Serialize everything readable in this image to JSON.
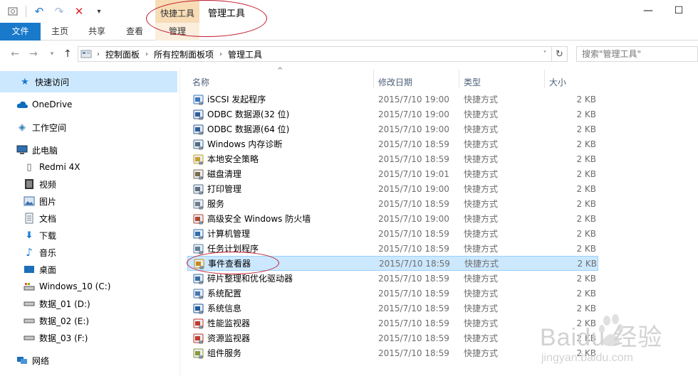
{
  "titlebar": {
    "qat_icons": [
      "properties-icon",
      "undo-icon",
      "redo-icon",
      "delete-icon",
      "dropdown-icon"
    ],
    "context_group": "快捷工具",
    "window_title": "管理工具",
    "minimize": "—",
    "maximize": "☐"
  },
  "ribbon": {
    "tabs": [
      "文件",
      "主页",
      "共享",
      "查看",
      "管理"
    ]
  },
  "address": {
    "crumbs": [
      "控制面板",
      "所有控制面板项",
      "管理工具"
    ],
    "search_placeholder": "搜索\"管理工具\""
  },
  "sidebar": {
    "items": [
      {
        "label": "快速访问",
        "icon": "star-icon",
        "color": "#1979ca"
      },
      {
        "label": "OneDrive",
        "icon": "cloud-icon",
        "color": "#0f6cbd"
      },
      {
        "label": "工作空间",
        "icon": "workspace-icon",
        "color": "#2f7fb5"
      },
      {
        "label": "此电脑",
        "icon": "computer-icon",
        "color": "#2e6fb0"
      },
      {
        "label": "Redmi 4X",
        "icon": "phone-icon",
        "color": "#555555"
      },
      {
        "label": "视频",
        "icon": "video-icon",
        "color": "#333333"
      },
      {
        "label": "图片",
        "icon": "pictures-icon",
        "color": "#3d6ea8"
      },
      {
        "label": "文档",
        "icon": "documents-icon",
        "color": "#6b7b8c"
      },
      {
        "label": "下载",
        "icon": "download-icon",
        "color": "#1c7ed6"
      },
      {
        "label": "音乐",
        "icon": "music-icon",
        "color": "#1c7ed6"
      },
      {
        "label": "桌面",
        "icon": "desktop-icon",
        "color": "#1c6fb8"
      },
      {
        "label": "Windows_10 (C:)",
        "icon": "drive-c-icon",
        "color": "#555555"
      },
      {
        "label": "数据_01 (D:)",
        "icon": "drive-icon",
        "color": "#555555"
      },
      {
        "label": "数据_02 (E:)",
        "icon": "drive-icon",
        "color": "#555555"
      },
      {
        "label": "数据_03 (F:)",
        "icon": "drive-icon",
        "color": "#555555"
      },
      {
        "label": "网络",
        "icon": "network-icon",
        "color": "#1c6fb8"
      }
    ]
  },
  "filelist": {
    "columns": [
      "名称",
      "修改日期",
      "类型",
      "大小"
    ],
    "rows": [
      {
        "name": "iSCSI 发起程序",
        "date": "2015/7/10 19:00",
        "type": "快捷方式",
        "size": "2 KB",
        "icon": "iscsi-icon"
      },
      {
        "name": "ODBC 数据源(32 位)",
        "date": "2015/7/10 19:00",
        "type": "快捷方式",
        "size": "2 KB",
        "icon": "odbc-icon"
      },
      {
        "name": "ODBC 数据源(64 位)",
        "date": "2015/7/10 19:00",
        "type": "快捷方式",
        "size": "2 KB",
        "icon": "odbc-icon"
      },
      {
        "name": "Windows 内存诊断",
        "date": "2015/7/10 18:59",
        "type": "快捷方式",
        "size": "2 KB",
        "icon": "memory-diagnostic-icon"
      },
      {
        "name": "本地安全策略",
        "date": "2015/7/10 18:59",
        "type": "快捷方式",
        "size": "2 KB",
        "icon": "security-policy-icon"
      },
      {
        "name": "磁盘清理",
        "date": "2015/7/10 19:01",
        "type": "快捷方式",
        "size": "2 KB",
        "icon": "disk-cleanup-icon"
      },
      {
        "name": "打印管理",
        "date": "2015/7/10 19:00",
        "type": "快捷方式",
        "size": "2 KB",
        "icon": "printer-icon"
      },
      {
        "name": "服务",
        "date": "2015/7/10 18:59",
        "type": "快捷方式",
        "size": "2 KB",
        "icon": "services-icon"
      },
      {
        "name": "高级安全 Windows 防火墙",
        "date": "2015/7/10 19:00",
        "type": "快捷方式",
        "size": "2 KB",
        "icon": "firewall-icon"
      },
      {
        "name": "计算机管理",
        "date": "2015/7/10 18:59",
        "type": "快捷方式",
        "size": "2 KB",
        "icon": "computer-management-icon"
      },
      {
        "name": "任务计划程序",
        "date": "2015/7/10 18:59",
        "type": "快捷方式",
        "size": "2 KB",
        "icon": "task-scheduler-icon"
      },
      {
        "name": "事件查看器",
        "date": "2015/7/10 18:59",
        "type": "快捷方式",
        "size": "2 KB",
        "icon": "event-viewer-icon",
        "selected": true
      },
      {
        "name": "碎片整理和优化驱动器",
        "date": "2015/7/10 18:59",
        "type": "快捷方式",
        "size": "2 KB",
        "icon": "defrag-icon"
      },
      {
        "name": "系统配置",
        "date": "2015/7/10 18:59",
        "type": "快捷方式",
        "size": "2 KB",
        "icon": "system-config-icon"
      },
      {
        "name": "系统信息",
        "date": "2015/7/10 18:59",
        "type": "快捷方式",
        "size": "2 KB",
        "icon": "system-info-icon"
      },
      {
        "name": "性能监视器",
        "date": "2015/7/10 18:59",
        "type": "快捷方式",
        "size": "2 KB",
        "icon": "performance-icon"
      },
      {
        "name": "资源监视器",
        "date": "2015/7/10 18:59",
        "type": "快捷方式",
        "size": "2 KB",
        "icon": "resource-monitor-icon"
      },
      {
        "name": "组件服务",
        "date": "2015/7/10 18:59",
        "type": "快捷方式",
        "size": "2 KB",
        "icon": "component-services-icon"
      }
    ]
  },
  "watermark": {
    "brand": "Baidu 经验",
    "url": "jingyan.baidu.com"
  },
  "colors": {
    "accent": "#1979ca",
    "selection": "#cce8ff",
    "context_tab": "#f8dcb6",
    "annotation": "#c0182b"
  }
}
